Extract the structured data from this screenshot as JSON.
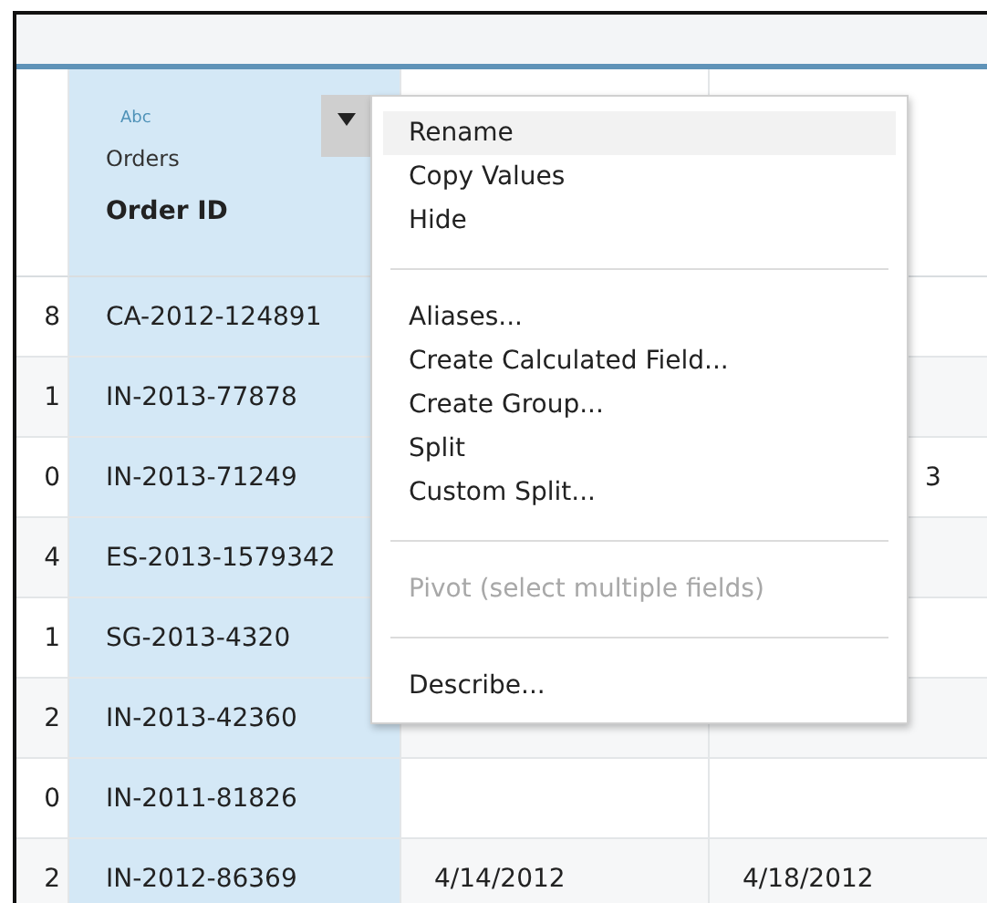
{
  "table": {
    "columns": [
      {
        "selected": false
      },
      {
        "field_type": "Abc",
        "source": "Orders",
        "name": "Order ID",
        "selected": true
      },
      {
        "selected": false
      },
      {
        "selected": false
      }
    ],
    "rows": [
      [
        "8",
        "CA-2012-124891",
        "",
        ""
      ],
      [
        "1",
        "IN-2013-77878",
        "",
        ""
      ],
      [
        "0",
        "IN-2013-71249",
        "",
        "3"
      ],
      [
        "4",
        "ES-2013-1579342",
        "",
        ""
      ],
      [
        "1",
        "SG-2013-4320",
        "",
        ""
      ],
      [
        "2",
        "IN-2013-42360",
        "",
        ""
      ],
      [
        "0",
        "IN-2011-81826",
        "",
        ""
      ],
      [
        "2",
        "IN-2012-86369",
        "4/14/2012",
        "4/18/2012"
      ]
    ]
  },
  "context_menu": {
    "items": [
      {
        "kind": "item",
        "label": "Rename",
        "highlighted": true,
        "disabled": false
      },
      {
        "kind": "item",
        "label": "Copy Values",
        "highlighted": false,
        "disabled": false
      },
      {
        "kind": "item",
        "label": "Hide",
        "highlighted": false,
        "disabled": false
      },
      {
        "kind": "separator"
      },
      {
        "kind": "item",
        "label": "Aliases...",
        "highlighted": false,
        "disabled": false
      },
      {
        "kind": "item",
        "label": "Create Calculated Field...",
        "highlighted": false,
        "disabled": false
      },
      {
        "kind": "item",
        "label": "Create Group...",
        "highlighted": false,
        "disabled": false
      },
      {
        "kind": "item",
        "label": "Split",
        "highlighted": false,
        "disabled": false
      },
      {
        "kind": "item",
        "label": "Custom Split...",
        "highlighted": false,
        "disabled": false
      },
      {
        "kind": "separator"
      },
      {
        "kind": "item",
        "label": "Pivot (select multiple fields)",
        "highlighted": false,
        "disabled": true
      },
      {
        "kind": "separator"
      },
      {
        "kind": "item",
        "label": "Describe...",
        "highlighted": false,
        "disabled": false
      }
    ]
  }
}
